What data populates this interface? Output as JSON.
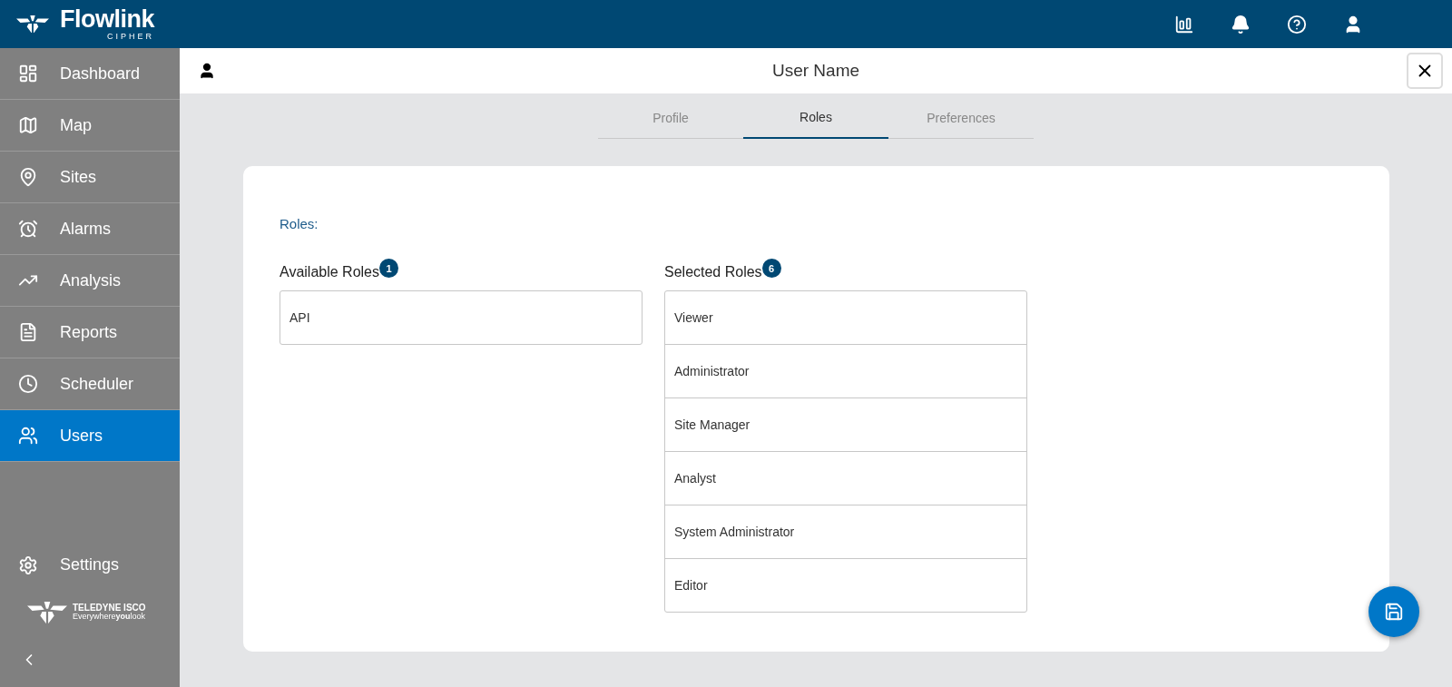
{
  "header": {
    "logo_name": "Flowlink",
    "logo_sub": "CIPHER"
  },
  "sidebar": {
    "items": [
      {
        "label": "Dashboard",
        "kind": "dashboard",
        "selected": false
      },
      {
        "label": "Map",
        "kind": "map",
        "selected": false
      },
      {
        "label": "Sites",
        "kind": "sites",
        "selected": false
      },
      {
        "label": "Alarms",
        "kind": "alarms",
        "selected": false
      },
      {
        "label": "Analysis",
        "kind": "analysis",
        "selected": false
      },
      {
        "label": "Reports",
        "kind": "reports",
        "selected": false
      },
      {
        "label": "Scheduler",
        "kind": "scheduler",
        "selected": false
      },
      {
        "label": "Users",
        "kind": "users",
        "selected": true
      }
    ],
    "settings": "Settings",
    "company": "TELEDYNE ISCO",
    "tagline": "Everywhere**you**look"
  },
  "panel": {
    "title": "User Name"
  },
  "tabs": [
    {
      "label": "Profile",
      "selected": false
    },
    {
      "label": "Roles",
      "selected": true
    },
    {
      "label": "Preferences",
      "selected": false
    }
  ],
  "roles": {
    "heading": "Roles:",
    "available": {
      "title": "Available Roles",
      "count": "1",
      "items": [
        "API"
      ]
    },
    "selected": {
      "title": "Selected Roles",
      "count": "6",
      "items": [
        "Viewer",
        "Administrator",
        "Site Manager",
        "Analyst",
        "System Administrator",
        "Editor"
      ]
    }
  }
}
